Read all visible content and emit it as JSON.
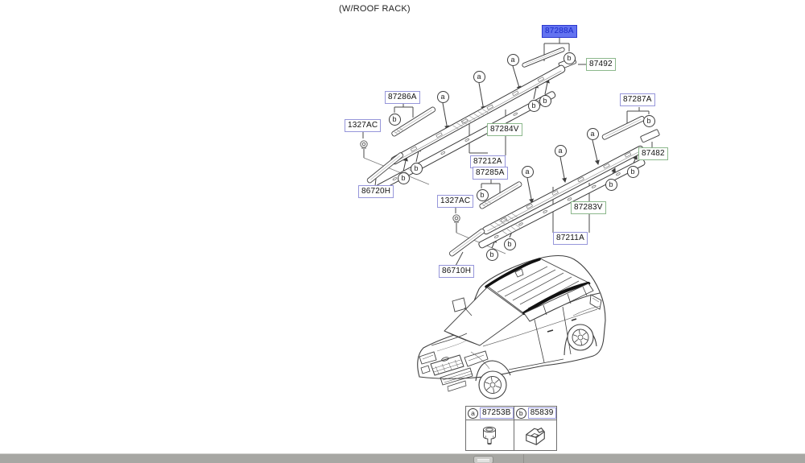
{
  "title": "(W/ROOF RACK)",
  "markers": {
    "a": "a",
    "b": "b"
  },
  "labels": [
    {
      "text": "87288A",
      "style": "selected"
    },
    {
      "text": "87492",
      "style": "green"
    },
    {
      "text": "87286A",
      "style": "blue"
    },
    {
      "text": "1327AC",
      "style": "blue"
    },
    {
      "text": "87284V",
      "style": "green"
    },
    {
      "text": "87212A",
      "style": "blue"
    },
    {
      "text": "87285A",
      "style": "blue"
    },
    {
      "text": "86720H",
      "style": "blue"
    },
    {
      "text": "1327AC",
      "style": "blue"
    },
    {
      "text": "86710H",
      "style": "blue"
    },
    {
      "text": "87287A",
      "style": "blue"
    },
    {
      "text": "87482",
      "style": "green"
    },
    {
      "text": "87283V",
      "style": "green"
    },
    {
      "text": "87211A",
      "style": "blue"
    }
  ],
  "legend": {
    "items": [
      {
        "marker": "a",
        "code": "87253B",
        "icon": "push-clip-icon"
      },
      {
        "marker": "b",
        "code": "85839",
        "icon": "sheet-clip-icon"
      }
    ]
  },
  "colors": {
    "selected_bg": "#6373f0",
    "selected_border": "#2c39d0",
    "selected_text": "#1b2ac8",
    "label_border_blue": "#9696da",
    "label_border_green": "#8cb88c",
    "line": "#3f3f3f",
    "statusbar": "#a7a7a3"
  }
}
